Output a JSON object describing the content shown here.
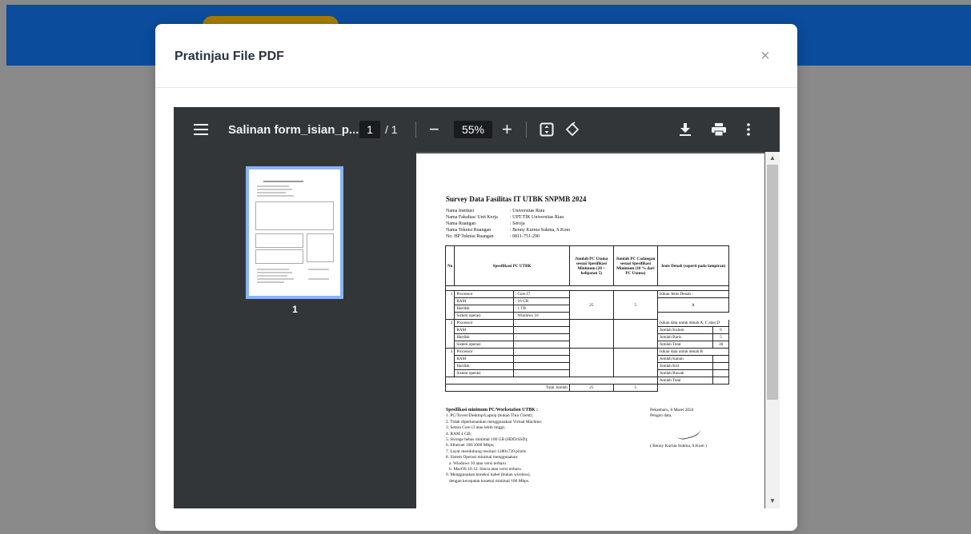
{
  "modal": {
    "title": "Pratinjau File PDF",
    "close_glyph": "×"
  },
  "viewer": {
    "file_name": "Salinan form_isian_p...",
    "current_page": "1",
    "total_pages": "/ 1",
    "zoom": "55%",
    "minus": "−",
    "plus": "+",
    "thumb_label": "1",
    "icons": [
      "menu-icon",
      "fit-page-icon",
      "rotate-icon",
      "download-icon",
      "print-icon",
      "more-icon"
    ]
  },
  "pdf": {
    "title": "Survey Data Fasilitas IT UTBK SNPMB 2024",
    "info": [
      {
        "k": "Nama Institusi",
        "v": ": Universitas Riau"
      },
      {
        "k": "Nama Fakultas/ Unit Kerja",
        "v": ": UPT.TIK Universitas Riau"
      },
      {
        "k": "Nama Ruangan",
        "v": ": Seroja"
      },
      {
        "k": "Nama Teknisi Ruangan",
        "v": ": Benny Kurnia Sukma, S.Kom"
      },
      {
        "k": "No. HP Teknisi Ruangan",
        "v": ": 0811-751-290"
      }
    ],
    "headers": {
      "no": "No",
      "spec": "Spesifikasi  PC UTBK",
      "utama": "Jumlah PC Utama sesuai Spesifikasi Minimum (20 + kelipatan 5)",
      "cadangan": "Jumlah PC Cadangan sesuai Spesifikasi Minimum (10 % dari PC Utama)",
      "denah": "Jenis Denah (seperti pada lampiran)"
    },
    "rows": [
      {
        "no": "1",
        "items": [
          "Processor",
          "RAM",
          "Hardisk",
          "Sistem operasi"
        ],
        "vals": [
          ": Core I7",
          ": 16 GB",
          ": 1 TB",
          ": Windows 10"
        ],
        "utama": "25",
        "cadangan": "5"
      },
      {
        "no": "2",
        "items": [
          "Processor",
          "RAM",
          "Hardisk",
          "Sistem operasi"
        ],
        "vals": [
          ":",
          ":",
          ":",
          ":"
        ],
        "utama": "",
        "cadangan": ""
      },
      {
        "no": "3",
        "items": [
          "Processor",
          "RAM",
          "Hardisk",
          "Sistem operasi"
        ],
        "vals": [
          ":",
          ":",
          ":",
          ":"
        ],
        "utama": "",
        "cadangan": ""
      }
    ],
    "denah": {
      "jenis_label": "Isikan Jenis Denah :",
      "jenis_value": "A",
      "ac_label": "Isikan data untuk denah A, C atau D",
      "ac_rows": [
        {
          "k": "Jumlah Kolom",
          "v": "6"
        },
        {
          "k": "Jumlah Baris",
          "v": "5"
        },
        {
          "k": "Jumlah Total",
          "v": "30"
        }
      ],
      "b_label": "Isikan data untuk denah B",
      "b_rows": [
        {
          "k": "Jumlah Kanan",
          "v": ""
        },
        {
          "k": "Jumlah Kiri",
          "v": ""
        },
        {
          "k": "Jumlah Bawah",
          "v": ""
        },
        {
          "k": "Jumlah Total",
          "v": ""
        }
      ]
    },
    "total": {
      "label": "Total Jumlah",
      "utama": "25",
      "cadangan": "5"
    },
    "notes_title": "Spesifikasi minimum PC/Workstation UTBK :",
    "notes": [
      "1. PC/Tower/Desktop/Laptop (bukan Thin Client);",
      "2. Tidak diperkenankan menggunakan Virtual Machine;",
      "3. Setara Core i3 atau lebih tinggi;",
      "4. RAM 4 GB;",
      "5. Storage bebas minimal 100 GB (HDD/SSD);",
      "6. Ethernet 100/1000 Mbps;",
      "7. Layar mendukung resolusi 1280x720 pixels",
      "8. Sistem Operasi minimal menggunakan:",
      "   a. Windows 10 atau versi terbaru",
      "   b. MacOS 10.12: Sierra atau versi terbaru",
      "9. Menggunakan koneksi kabel (bukan wireless),",
      "   dengan kecepatan koneksi minimal 100 Mbps."
    ],
    "sign_place": "Pekanbaru, 6 Maret 2024",
    "sign_role": "Pengisi data,",
    "sign_name": "( Benny Kurnia Sukma, S.Kom )"
  }
}
